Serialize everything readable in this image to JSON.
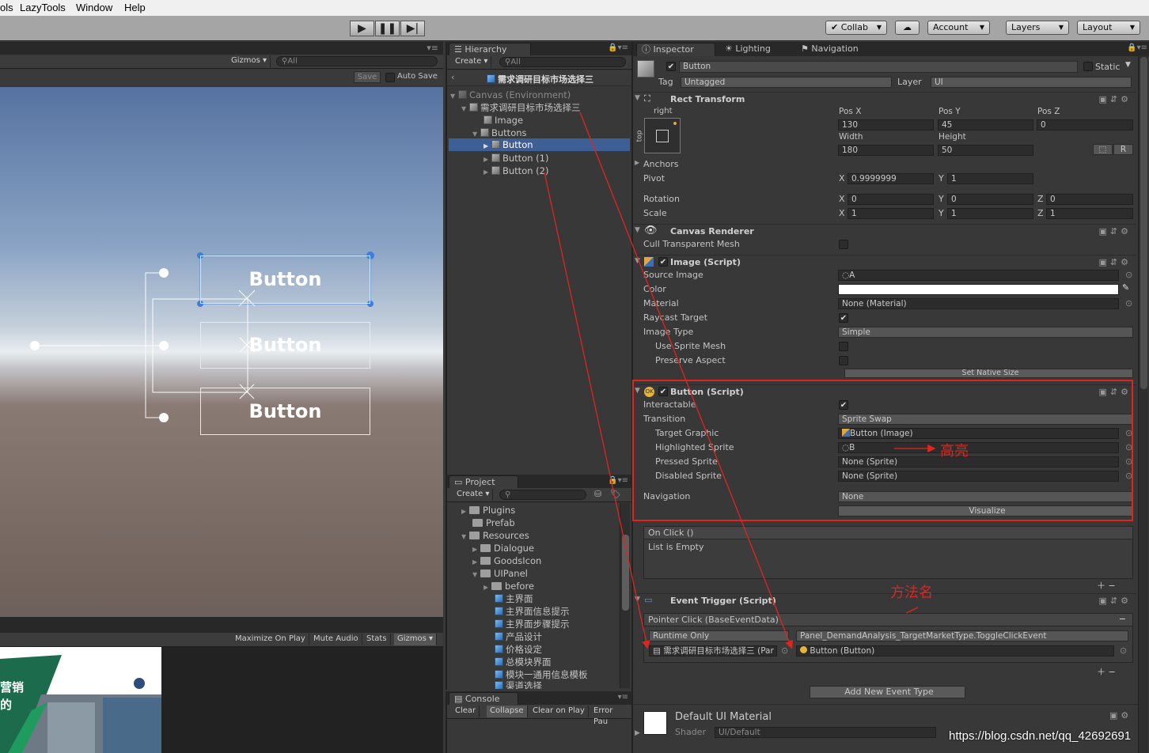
{
  "menu": {
    "items": [
      "ols",
      "LazyTools",
      "Window",
      "Help"
    ]
  },
  "toolbar": {
    "play_icon": "play-icon",
    "pause_icon": "pause-icon",
    "step_icon": "step-icon",
    "collab": "Collab",
    "account": "Account",
    "layers": "Layers",
    "layout": "Layout"
  },
  "scene": {
    "gizmos": "Gizmos",
    "search_placeholder": "All",
    "save": "Save",
    "auto_save": "Auto Save",
    "buttons": [
      "Button",
      "Button",
      "Button"
    ],
    "game_bar": [
      "Maximize On Play",
      "Mute Audio",
      "Stats",
      "Gizmos"
    ],
    "banner_text_1": "营销",
    "banner_text_2": "的"
  },
  "hierarchy": {
    "tab": "Hierarchy",
    "create": "Create",
    "search_placeholder": "All",
    "scene_title": "需求调研目标市场选择三",
    "items": [
      {
        "label": "Canvas (Environment)"
      },
      {
        "label": "需求调研目标市场选择三"
      },
      {
        "label": "Image"
      },
      {
        "label": "Buttons"
      },
      {
        "label": "Button"
      },
      {
        "label": "Button (1)"
      },
      {
        "label": "Button (2)"
      }
    ]
  },
  "project": {
    "tab": "Project",
    "create": "Create",
    "items": [
      {
        "label": "Plugins"
      },
      {
        "label": "Prefab"
      },
      {
        "label": "Resources"
      },
      {
        "label": "Dialogue"
      },
      {
        "label": "GoodsIcon"
      },
      {
        "label": "UIPanel"
      },
      {
        "label": "before"
      },
      {
        "label": "主界面"
      },
      {
        "label": "主界面信息提示"
      },
      {
        "label": "主界面步骤提示"
      },
      {
        "label": "产品设计"
      },
      {
        "label": "价格设定"
      },
      {
        "label": "总模块界面"
      },
      {
        "label": "模块一通用信息模板"
      },
      {
        "label": "渠道选择"
      }
    ]
  },
  "console": {
    "tab": "Console",
    "buttons": [
      "Clear",
      "Collapse",
      "Clear on Play",
      "Error Pau"
    ]
  },
  "inspector": {
    "tabs": [
      "Inspector",
      "Lighting",
      "Navigation"
    ],
    "object_name": "Button",
    "static": "Static",
    "tag_label": "Tag",
    "tag_value": "Untagged",
    "layer_label": "Layer",
    "layer_value": "UI",
    "rect": {
      "title": "Rect Transform",
      "anchor_h": "right",
      "anchor_v": "top",
      "pos_x_label": "Pos X",
      "pos_y_label": "Pos Y",
      "pos_z_label": "Pos Z",
      "pos_x": "130",
      "pos_y": "45",
      "pos_z": "0",
      "width_label": "Width",
      "height_label": "Height",
      "width": "180",
      "height": "50",
      "anchors": "Anchors",
      "pivot": "Pivot",
      "pivot_x": "0.9999999",
      "pivot_y": "1",
      "rotation": "Rotation",
      "rot_x": "0",
      "rot_y": "0",
      "rot_z": "0",
      "scale": "Scale",
      "scale_x": "1",
      "scale_y": "1",
      "scale_z": "1",
      "x": "X",
      "y": "Y",
      "z": "Z",
      "r_btn": "R"
    },
    "canvas_renderer": {
      "title": "Canvas Renderer",
      "cull": "Cull Transparent Mesh"
    },
    "image": {
      "title": "Image (Script)",
      "labels": [
        "Source Image",
        "Color",
        "Material",
        "Raycast Target",
        "Image Type",
        "Use Sprite Mesh",
        "Preserve Aspect"
      ],
      "source": "A",
      "material": "None (Material)",
      "type": "Simple",
      "native": "Set Native Size"
    },
    "button": {
      "title": "Button (Script)",
      "labels": [
        "Interactable",
        "Transition",
        "Target Graphic",
        "Highlighted Sprite",
        "Pressed Sprite",
        "Disabled Sprite",
        "Navigation"
      ],
      "transition": "Sprite Swap",
      "target": "Button (Image)",
      "highlighted": "B",
      "pressed": "None (Sprite)",
      "disabled": "None (Sprite)",
      "navigation": "None",
      "visualize": "Visualize"
    },
    "onclick": {
      "title": "On Click ()",
      "empty": "List is Empty"
    },
    "event_trigger": {
      "title": "Event Trigger (Script)",
      "entry": "Pointer Click (BaseEventData)",
      "runtime": "Runtime Only",
      "method": "Panel_DemandAnalysis_TargetMarketType.ToggleClickEvent",
      "object": "需求调研目标市场选择三 (Par",
      "target": "Button (Button)",
      "add": "Add New Event Type"
    },
    "material": {
      "name": "Default UI Material",
      "shader_label": "Shader",
      "shader": "UI/Default"
    }
  },
  "annotations": {
    "highlight": "高亮",
    "method_name": "方法名",
    "watermark": "https://blog.csdn.net/qq_42692691"
  },
  "colors": {
    "accent_red": "#e0251f",
    "selection": "#3e5f96"
  }
}
